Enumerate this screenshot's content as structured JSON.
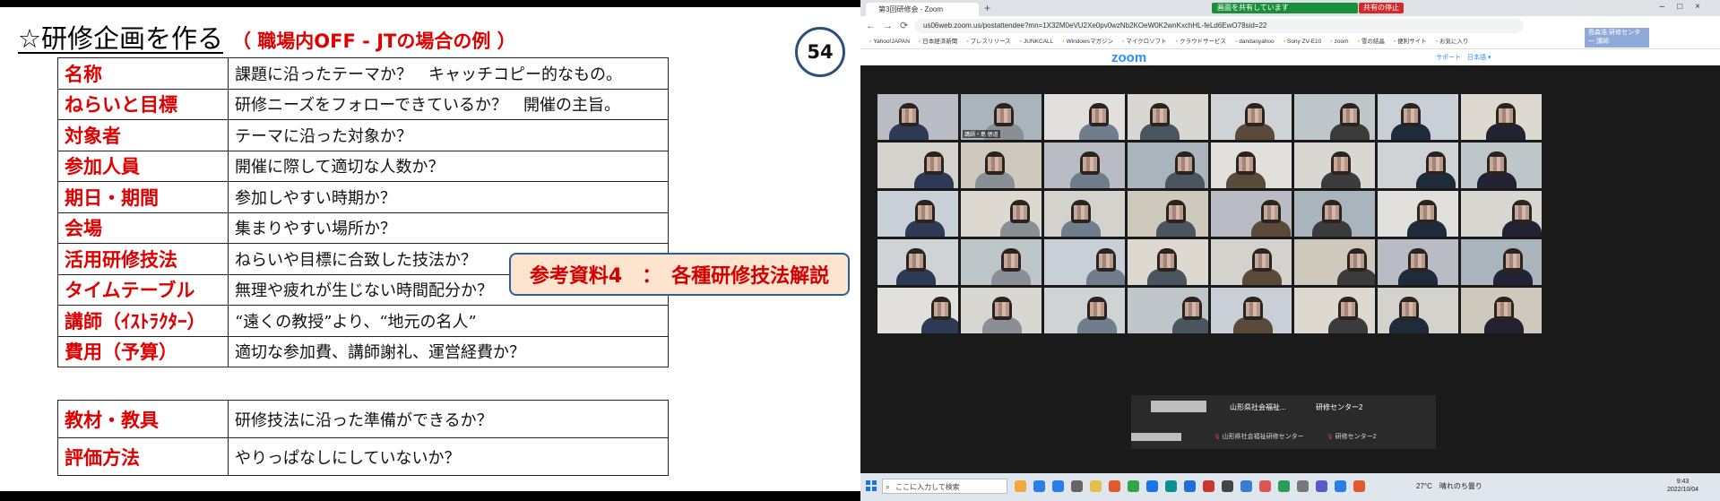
{
  "slide": {
    "title": "☆研修企画を作る",
    "subtitle": "（ 職場内OFF - JTの場合の例 ）",
    "page_number": "54",
    "rows": [
      {
        "label": "名称",
        "text": "課題に沿ったテーマか？　キャッチコピー的なもの。"
      },
      {
        "label": "ねらいと目標",
        "text": "研修ニーズをフォローできているか？　開催の主旨。"
      },
      {
        "label": "対象者",
        "text": "テーマに沿った対象か？"
      },
      {
        "label": "参加人員",
        "text": "開催に際して適切な人数か？"
      },
      {
        "label": "期日・期間",
        "text": "参加しやすい時期か？"
      },
      {
        "label": "会場",
        "text": "集まりやすい場所か？"
      },
      {
        "label": "活用研修技法",
        "text": "ねらいや目標に合致した技法か？"
      },
      {
        "label": "タイムテーブル",
        "text": "無理や疲れが生じない時間配分か？"
      },
      {
        "label": "講師（ｲｽﾄﾗｸﾀｰ）",
        "text": "“遠くの教授”より、“地元の名人”"
      },
      {
        "label": "費用（予算）",
        "text": "適切な参加費、講師謝礼、運営経費か？"
      }
    ],
    "rows2": [
      {
        "label": "教材・教具",
        "text": "研修技法に沿った準備ができるか？"
      },
      {
        "label": "評価方法",
        "text": "やりっぱなしにしていないか？"
      }
    ],
    "callout": "参考資料4　：　各種研修技法解説"
  },
  "screen": {
    "share_banner": "画面を共有しています",
    "stop_share": "共有の停止",
    "tab_title": "第3回研修会 - Zoom",
    "url": "us06web.zoom.us/postattendee?mn=1X32M0eVU2Xe0pv0wzNb2KOeW0K2wnKxchHL-feLd6EwO78sid=22",
    "badge": "島森浩 研修センター 講師",
    "bookmarks": [
      "Yahoo!JAPAN",
      "日本経済新聞",
      "プレスリリース",
      "JUNKCALL",
      "Windowsマガジン",
      "マイクロソフト",
      "クラウドサービス",
      "dandanyahoo",
      "Sony ZV-E10",
      "zoom",
      "雪の結晶",
      "便利サイト",
      "お気に入り"
    ],
    "zoom_logo": "zoom",
    "zoom_links": "サポート　日本語 ▾",
    "speaker_label": "講師・島 徳道",
    "bottom_names": [
      "山形県社会福祉...",
      "研修センター2"
    ],
    "bottom_subs": [
      "山形県社会福祉研修センター",
      "研修センター2"
    ],
    "taskbar_search": "ここに入力して検索",
    "tray_text": "27°C　晴れのち曇り",
    "clock_time": "9:43",
    "clock_date": "2022/10/04"
  }
}
